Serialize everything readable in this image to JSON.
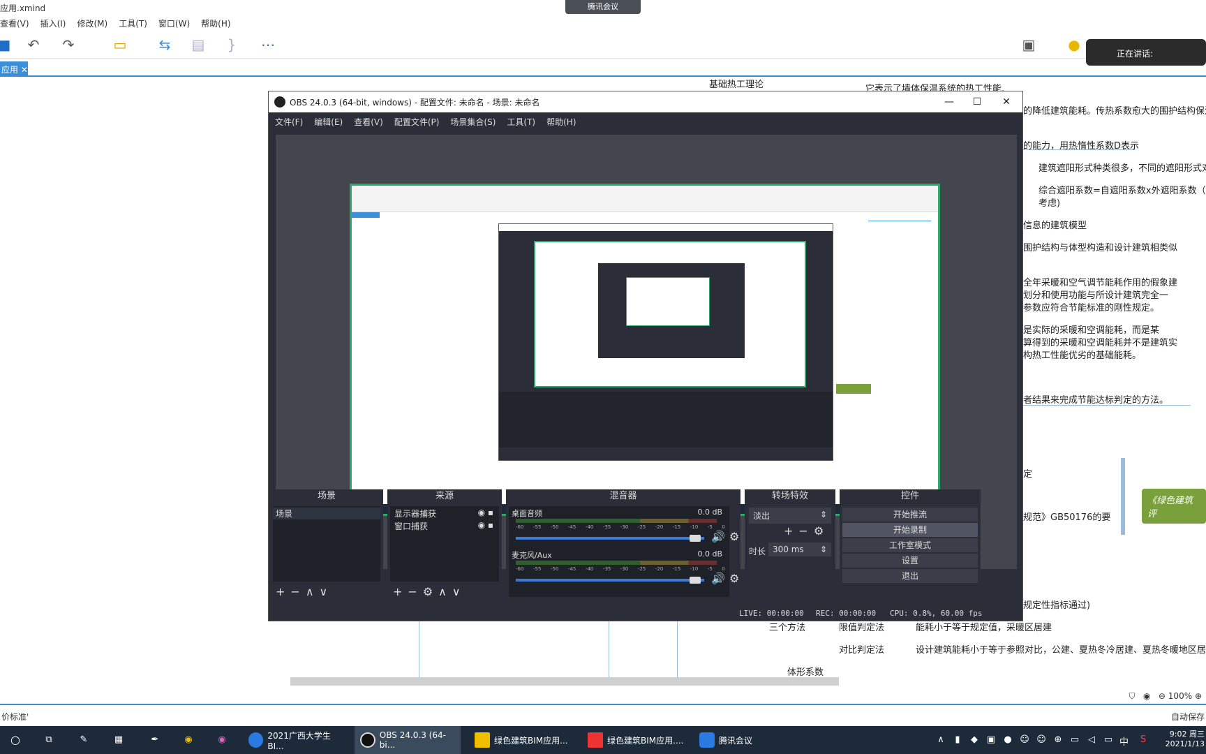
{
  "xmind": {
    "title": "应用.xmind",
    "menu": [
      "查看(V)",
      "插入(I)",
      "修改(M)",
      "工具(T)",
      "窗口(W)",
      "帮助(H)"
    ],
    "tab_label": "应用",
    "status_left": "价标准'",
    "status_right": "自动保存",
    "zoom": "100%",
    "speaking_label": "正在讲话:",
    "mind_texts": [
      "基础热工理论",
      "它表示了墙体保温系统的热工性能,",
      "的降低建筑能耗。传热系数愈大的围护结构保温",
      "的能力，用热惰性系数D表示",
      "建筑遮阳形式种类很多，不同的遮阳形式对",
      "综合遮阳系数=自遮阳系数x外遮阳系数（f",
      "考虑)",
      "信息的建筑模型",
      "围护结构与体型构造和设计建筑相类似",
      "全年采暖和空气调节能耗作用的假象建",
      "划分和使用功能与所设计建筑完全一",
      "参数应符合节能标准的刚性规定。",
      "是实际的采暖和空调能耗，而是某",
      "算得到的采暖和空调能耗并不是建筑实",
      "构热工性能优劣的基础能耗。",
      "者结果来完成节能达标判定的方法。",
      "定",
      "规范》GB50176的要",
      "规定性指标通过)",
      "三个方法",
      "限值判定法",
      "能耗小于等于规定值，采暖区居建",
      "对比判定法",
      "设计建筑能耗小于等于参照对比，公建、夏热冬冷居建、夏热冬暖地区居",
      "体形系数"
    ],
    "green_node": "《绿色建筑评"
  },
  "tencent_meeting": "腾讯会议",
  "obs": {
    "title": "OBS 24.0.3 (64-bit, windows) - 配置文件: 未命名 - 场景: 未命名",
    "menu": [
      "文件(F)",
      "编辑(E)",
      "查看(V)",
      "配置文件(P)",
      "场景集合(S)",
      "工具(T)",
      "帮助(H)"
    ],
    "docks": {
      "scenes": {
        "title": "场景",
        "items": [
          "场景"
        ]
      },
      "sources": {
        "title": "来源",
        "items": [
          "显示器捕获",
          "窗口捕获"
        ]
      },
      "mixer": {
        "title": "混音器",
        "channels": [
          {
            "name": "桌面音频",
            "db": "0.0 dB",
            "volume": 0.95
          },
          {
            "name": "麦克风/Aux",
            "db": "0.0 dB",
            "volume": 0.95
          }
        ],
        "ticks": [
          "-60",
          "-55",
          "-50",
          "-45",
          "-40",
          "-35",
          "-30",
          "-25",
          "-20",
          "-15",
          "-10",
          "-5",
          "0"
        ]
      },
      "transitions": {
        "title": "转场特效",
        "selected": "淡出",
        "duration_label": "时长",
        "duration": "300 ms"
      },
      "controls": {
        "title": "控件",
        "buttons": [
          "开始推流",
          "开始录制",
          "工作室模式",
          "设置",
          "退出"
        ]
      }
    },
    "status": {
      "live": "LIVE: 00:00:00",
      "rec": "REC: 00:00:00",
      "cpu": "CPU: 0.8%, 60.00 fps"
    }
  },
  "taskbar": {
    "apps": [
      "2021广西大学生BI...",
      "OBS 24.0.3 (64-bi...",
      "绿色建筑BIM应用...",
      "绿色建筑BIM应用....",
      "腾讯会议"
    ],
    "time": "9:02 周三",
    "date": "2021/1/13",
    "ime": "中"
  }
}
